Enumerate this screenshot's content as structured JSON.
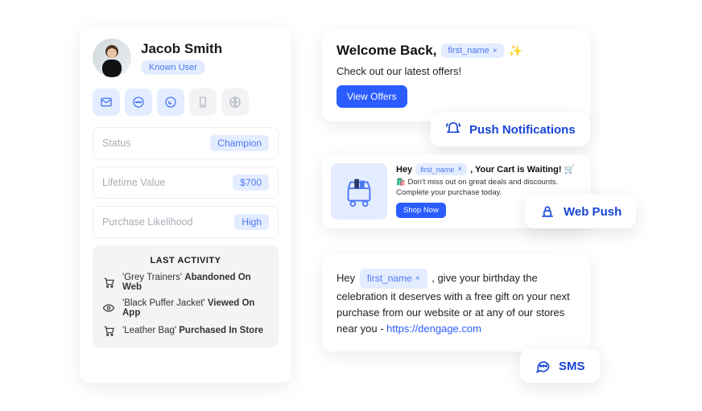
{
  "profile": {
    "name": "Jacob Smith",
    "tag": "Known User",
    "stats": {
      "status_label": "Status",
      "status_value": "Champion",
      "ltv_label": "Lifetime Value",
      "ltv_value": "$700",
      "pl_label": "Purchase Likelihood",
      "pl_value": "High"
    },
    "activity": {
      "heading": "LAST ACTIVITY",
      "items": [
        {
          "product": "'Grey Trainers'",
          "action": "Abandoned On Web",
          "icon": "cart-icon"
        },
        {
          "product": "'Black Puffer Jacket'",
          "action": "Viewed On App",
          "icon": "eye-icon"
        },
        {
          "product": "'Leather Bag'",
          "action": "Purchased In Store",
          "icon": "cart-icon"
        }
      ]
    }
  },
  "welcome": {
    "title": "Welcome Back,",
    "token": "first_name",
    "sparkle": "✨",
    "subtitle": "Check out our latest offers!",
    "button": "View Offers"
  },
  "pills": {
    "push": "Push Notifications",
    "webpush": "Web Push",
    "sms": "SMS"
  },
  "cart": {
    "title_pre": "Hey",
    "token": "first_name",
    "title_post": ", Your Cart is Waiting! 🛒",
    "desc": "🛍️ Don't miss out on great deals and discounts. Complete your purchase today.",
    "button": "Shop Now"
  },
  "sms": {
    "pre": "Hey ",
    "token": "first_name",
    "mid": " , give your birthday the celebration it deserves with a free gift on your next purchase from our website or at any of our stores near you - ",
    "link": "https://dengage.com"
  }
}
